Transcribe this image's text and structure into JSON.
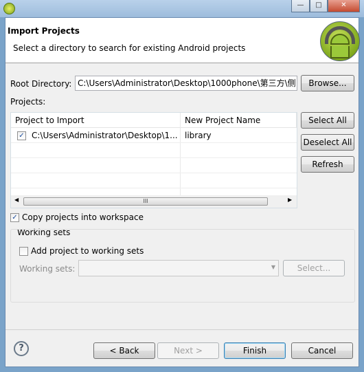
{
  "window": {
    "title_icon": "eclipse-android-icon",
    "controls": {
      "minimize": "—",
      "maximize": "□",
      "close": "✕"
    }
  },
  "header": {
    "title": "Import Projects",
    "subtitle": "Select a directory to search for existing Android projects",
    "logo": "android-logo"
  },
  "root": {
    "label": "Root Directory:",
    "value": "C:\\Users\\Administrator\\Desktop\\1000phone\\第三方\\侧",
    "browse": "Browse..."
  },
  "projects": {
    "label": "Projects:",
    "columns": [
      "Project to Import",
      "New Project Name"
    ],
    "rows": [
      {
        "checked": true,
        "path": "C:\\Users\\Administrator\\Desktop\\1...",
        "name": "library"
      }
    ],
    "scroll_thumb": "III"
  },
  "side_buttons": {
    "select_all": "Select All",
    "deselect_all": "Deselect All",
    "refresh": "Refresh"
  },
  "copy": {
    "label": "Copy projects into workspace",
    "checked": true
  },
  "working_sets": {
    "group_label": "Working sets",
    "add_label": "Add project to working sets",
    "add_checked": false,
    "combo_label": "Working sets:",
    "combo_value": "",
    "select_button": "Select..."
  },
  "footer": {
    "help": "?",
    "back": "< Back",
    "next": "Next >",
    "finish": "Finish",
    "cancel": "Cancel"
  }
}
